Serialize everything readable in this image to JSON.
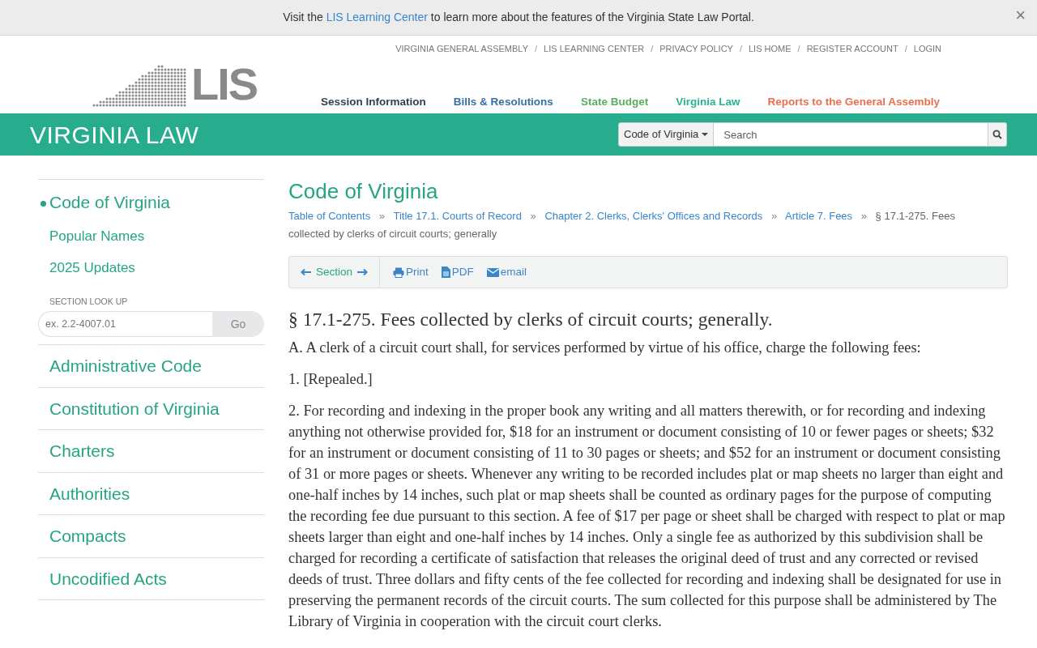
{
  "banner": {
    "before": "Visit the",
    "link": "LIS Learning Center",
    "after": "to learn more about the features of the Virginia State Law Portal.",
    "close": "×"
  },
  "top_link_separator": "/",
  "top_links": [
    "VIRGINIA GENERAL ASSEMBLY",
    "LIS LEARNING CENTER",
    "PRIVACY POLICY",
    "LIS HOME",
    "REGISTER ACCOUNT",
    "LOGIN"
  ],
  "logo": {
    "text": "LIS"
  },
  "main_nav": [
    {
      "label": "Session Information",
      "color": "#333f4f"
    },
    {
      "label": "Bills & Resolutions",
      "color": "#3a6ea5"
    },
    {
      "label": "State Budget",
      "color": "#5cae5c"
    },
    {
      "label": "Virginia Law",
      "color": "#2bb491"
    },
    {
      "label": "Reports to the General Assembly",
      "color": "#e8704f"
    }
  ],
  "section_bar": {
    "title": "VIRGINIA LAW",
    "scope": "Code of Virginia",
    "search_placeholder": "Search"
  },
  "sidebar": {
    "items": [
      {
        "label": "Code of Virginia",
        "selected": true,
        "children": [
          {
            "label": "Popular Names"
          },
          {
            "label": "2025 Updates"
          }
        ]
      },
      {
        "label": "Administrative Code",
        "selected": false
      },
      {
        "label": "Constitution of Virginia",
        "selected": false
      },
      {
        "label": "Charters",
        "selected": false
      },
      {
        "label": "Authorities",
        "selected": false
      },
      {
        "label": "Compacts",
        "selected": false
      },
      {
        "label": "Uncodified Acts",
        "selected": false
      }
    ],
    "lookup": {
      "label": "SECTION LOOK UP",
      "placeholder": "ex. 2.2-4007.01",
      "button": "Go"
    }
  },
  "content": {
    "heading": "Code of Virginia",
    "breadcrumbs": [
      "Table of Contents",
      "Title 17.1. Courts of Record",
      "Chapter 2. Clerks, Clerks' Offices and Records",
      "Article 7. Fees"
    ],
    "breadcrumb_separator": "»",
    "current": [
      "§ 17.1-275. Fees",
      "collected by clerks of circuit courts; generally"
    ],
    "toolbar": {
      "section": "Section",
      "actions": [
        {
          "kind": "print",
          "label": "Print"
        },
        {
          "kind": "pdf",
          "label": "PDF"
        },
        {
          "kind": "email",
          "label": "email"
        }
      ]
    },
    "section_title": "§ 17.1-275. Fees collected by clerks of circuit courts; generally.",
    "paragraphs": [
      "A. A clerk of a circuit court shall, for services performed by virtue of his office, charge the following fees:",
      "1. [Repealed.]",
      "2. For recording and indexing in the proper book any writing and all matters therewith, or for recording and indexing anything not otherwise provided for, $18 for an instrument or document consisting of 10 or fewer pages or sheets; $32 for an instrument or document consisting of 11 to 30 pages or sheets; and $52 for an instrument or document consisting of 31 or more pages or sheets. Whenever any writing to be recorded includes plat or map sheets no larger than eight and one-half inches by 14 inches, such plat or map sheets shall be counted as ordinary pages for the purpose of computing the recording fee due pursuant to this section. A fee of $17 per page or sheet shall be charged with respect to plat or map sheets larger than eight and one-half inches by 14 inches. Only a single fee as authorized by this subdivision shall be charged for recording a certificate of satisfaction that releases the original deed of trust and any corrected or revised deeds of trust. Three dollars and fifty cents of the fee collected for recording and indexing shall be designated for use in preserving the permanent records of the circuit courts. The sum collected for this purpose shall be administered by The Library of Virginia in cooperation with the circuit court clerks."
    ]
  }
}
